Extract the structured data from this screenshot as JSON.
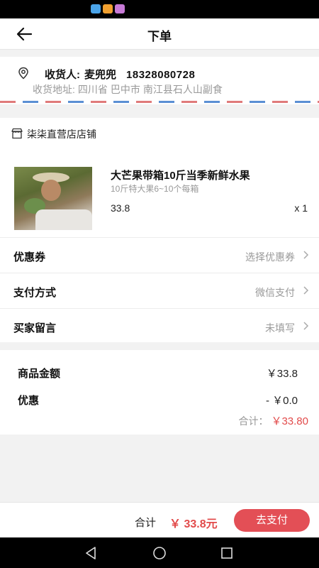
{
  "status_bar": {
    "icons": [
      "app-notification-icon",
      "video-app-icon",
      "app-badge-icon"
    ],
    "icon_colors": [
      "#4aa3e8",
      "#f0a030",
      "#c77ad6"
    ]
  },
  "header": {
    "back_icon": "arrow-left-icon",
    "title": "下单"
  },
  "address": {
    "location_icon": "location-pin-icon",
    "receiver_label": "收货人:",
    "receiver_name": "麦兜兜",
    "phone": "18328080728",
    "address_label": "收货地址:",
    "province": "四川省",
    "city": "巴中市",
    "detail": "南江县石人山副食"
  },
  "shop": {
    "icon": "shop-icon",
    "name": "柒柒直营店店铺"
  },
  "product": {
    "title": "大芒果带箱10斤当季新鲜水果",
    "spec": "10斤特大果6~10个每箱",
    "price": "33.8",
    "quantity": "x 1"
  },
  "options": [
    {
      "label": "优惠券",
      "value": "选择优惠券"
    },
    {
      "label": "支付方式",
      "value": "微信支付"
    },
    {
      "label": "买家留言",
      "value": "未填写"
    }
  ],
  "summary": {
    "goods_label": "商品金额",
    "goods_value": "￥33.8",
    "discount_label": "优惠",
    "discount_value": "- ￥0.0",
    "total_label": "合计：",
    "total_value": "￥33.80"
  },
  "bottom_bar": {
    "total_label": "合计",
    "total_amount": "￥ 33.8元",
    "pay_button": "去支付"
  },
  "colors": {
    "accent_red": "#e24b4b",
    "pay_button": "#e34f56",
    "stripe_red": "#e07a7a",
    "stripe_blue": "#5b8fd4"
  },
  "nav": {
    "back": "nav-back-icon",
    "home": "nav-home-icon",
    "recents": "nav-recents-icon"
  }
}
